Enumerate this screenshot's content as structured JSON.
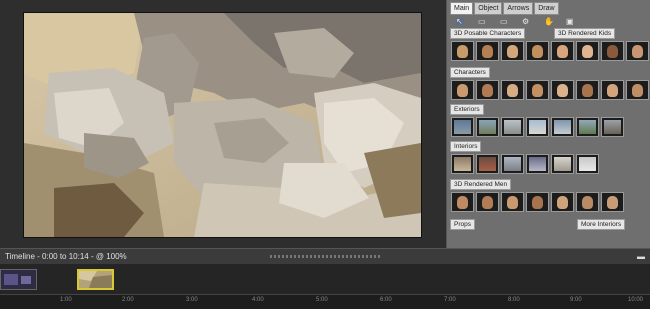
{
  "tabs": [
    {
      "label": "Main",
      "active": true
    },
    {
      "label": "Object",
      "active": false
    },
    {
      "label": "Arrows",
      "active": false
    },
    {
      "label": "Draw",
      "active": false
    }
  ],
  "toolbar_icons": [
    "pointer-icon",
    "rectangle-icon",
    "monitor-icon",
    "gear-icon",
    "hand-icon",
    "camera-icon"
  ],
  "sections": {
    "posable": "3D Posable Characters",
    "kids": "3D Rendered Kids",
    "characters": "Characters",
    "exteriors": "Exteriors",
    "interiors": "Interiors",
    "men": "3D Rendered Men",
    "props": "Props",
    "more_interiors": "More Interiors"
  },
  "timeline": {
    "label": "Timeline - 0:00 to 10:14 - @ 100%",
    "ticks": [
      "1:00",
      "2:00",
      "3:00",
      "4:00",
      "5:00",
      "6:00",
      "7:00",
      "8:00",
      "9:00",
      "10:00"
    ]
  },
  "colors": {
    "panel_bg": "#6f6f6f",
    "selected_clip_border": "#d8c832"
  }
}
